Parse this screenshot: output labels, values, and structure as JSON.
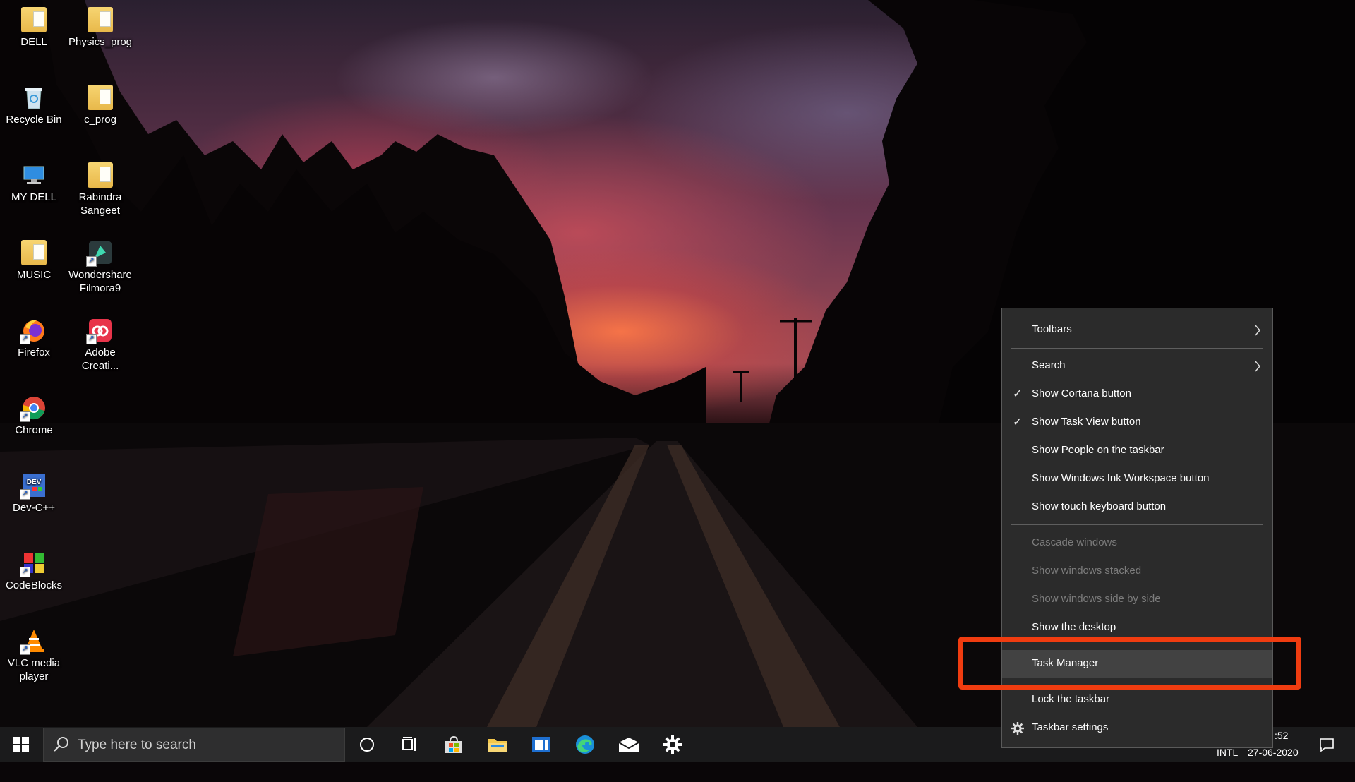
{
  "desktop": {
    "icons": [
      {
        "label": "DELL"
      },
      {
        "label": "Physics_prog"
      },
      {
        "label": "Recycle Bin"
      },
      {
        "label": "c_prog"
      },
      {
        "label": "MY DELL"
      },
      {
        "label": "Rabindra Sangeet"
      },
      {
        "label": "MUSIC"
      },
      {
        "label": "Wondershare Filmora9"
      },
      {
        "label": "Firefox"
      },
      {
        "label": "Adobe Creati..."
      },
      {
        "label": "Chrome"
      },
      {
        "label": "Dev-C++"
      },
      {
        "label": "CodeBlocks"
      },
      {
        "label": "VLC media player"
      }
    ]
  },
  "context_menu": {
    "items": [
      {
        "label": "Toolbars",
        "submenu": true,
        "checked": false,
        "enabled": true
      },
      {
        "label": "Search",
        "submenu": true,
        "checked": false,
        "enabled": true
      },
      {
        "label": "Show Cortana button",
        "checked": true,
        "enabled": true
      },
      {
        "label": "Show Task View button",
        "checked": true,
        "enabled": true
      },
      {
        "label": "Show People on the taskbar",
        "checked": false,
        "enabled": true
      },
      {
        "label": "Show Windows Ink Workspace button",
        "checked": false,
        "enabled": true
      },
      {
        "label": "Show touch keyboard button",
        "checked": false,
        "enabled": true
      },
      {
        "label": "Cascade windows",
        "enabled": false
      },
      {
        "label": "Show windows stacked",
        "enabled": false
      },
      {
        "label": "Show windows side by side",
        "enabled": false
      },
      {
        "label": "Show the desktop",
        "enabled": true
      },
      {
        "label": "Task Manager",
        "enabled": true,
        "highlighted": true
      },
      {
        "label": "Lock the taskbar",
        "enabled": true
      },
      {
        "label": "Taskbar settings",
        "enabled": true,
        "icon": "gear-icon"
      }
    ],
    "highlight_color": "#f03c10"
  },
  "taskbar": {
    "search_placeholder": "Type here to search",
    "pinned": [
      "cortana-icon",
      "task-view-icon",
      "store-icon",
      "file-explorer-icon",
      "news-icon",
      "edge-icon",
      "mail-icon",
      "settings-icon"
    ],
    "tray": {
      "time_partial": ":52",
      "language": "INTL",
      "date": "27-06-2020"
    }
  }
}
